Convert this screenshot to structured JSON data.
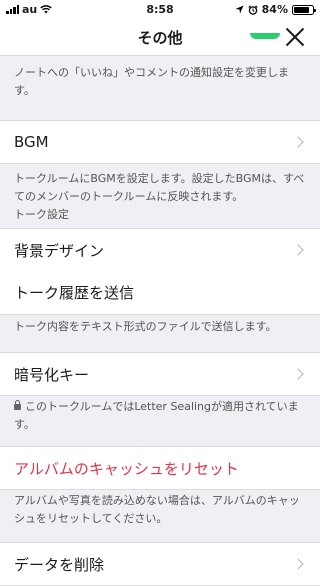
{
  "status_bar": {
    "carrier": "au",
    "time": "8:58",
    "battery": "84%",
    "battery_level": 0.84
  },
  "nav": {
    "title": "その他",
    "close_icon": "close-icon"
  },
  "notes": {
    "notification": "ノートへの「いいね」やコメントの通知設定を変更します。",
    "bgm": "トークルームにBGMを設定します。設定したBGMは、すべてのメンバーのトークルームに反映されます。",
    "talk_settings_header": "トーク設定",
    "send_history": "トーク内容をテキスト形式のファイルで送信します。",
    "encryption": "このトークルームではLetter Sealingが適用されています。",
    "reset_cache": "アルバムや写真を読み込めない場合は、アルバムのキャッシュをリセットしてください。"
  },
  "cells": {
    "bgm": "BGM",
    "background_design": "背景デザイン",
    "send_history": "トーク履歴を送信",
    "encryption_key": "暗号化キー",
    "reset_album_cache": "アルバムのキャッシュをリセット",
    "delete_data": "データを削除"
  },
  "colors": {
    "destructive": "#e0344a",
    "accent_green": "#2ecc71"
  }
}
